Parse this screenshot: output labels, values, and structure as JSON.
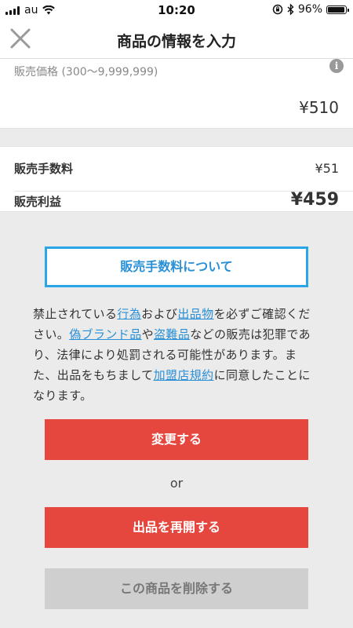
{
  "status_bar": {
    "carrier": "au",
    "time": "10:20",
    "battery_percent": "96%",
    "battery_level": 0.96
  },
  "nav": {
    "title": "商品の情報を入力"
  },
  "price": {
    "range_label": "販売価格 (300〜9,999,999)",
    "value": "¥510"
  },
  "fees": {
    "fee_label": "販売手数料",
    "fee_value": "¥51",
    "profit_label": "販売利益",
    "profit_value": "¥459"
  },
  "fee_about_button": "販売手数料について",
  "notice": {
    "t1": "禁止されている",
    "link1": "行為",
    "t2": "および",
    "link2": "出品物",
    "t3": "を必ずご確認ください。",
    "link3": "偽ブランド品",
    "t4": "や",
    "link4": "盗難品",
    "t5": "などの販売は犯罪であり、法律により処罰される可能性があります。また、出品をもちまして",
    "link5": "加盟店規約",
    "t6": "に同意したことになります。"
  },
  "actions": {
    "change_label": "変更する",
    "or_label": "or",
    "resume_label": "出品を再開する",
    "delete_label": "この商品を削除する"
  },
  "colors": {
    "accent_red": "#e5463e",
    "link_blue": "#2a90d6",
    "outline_blue": "#2aa5e6",
    "disabled_gray": "#cfcfcf"
  }
}
